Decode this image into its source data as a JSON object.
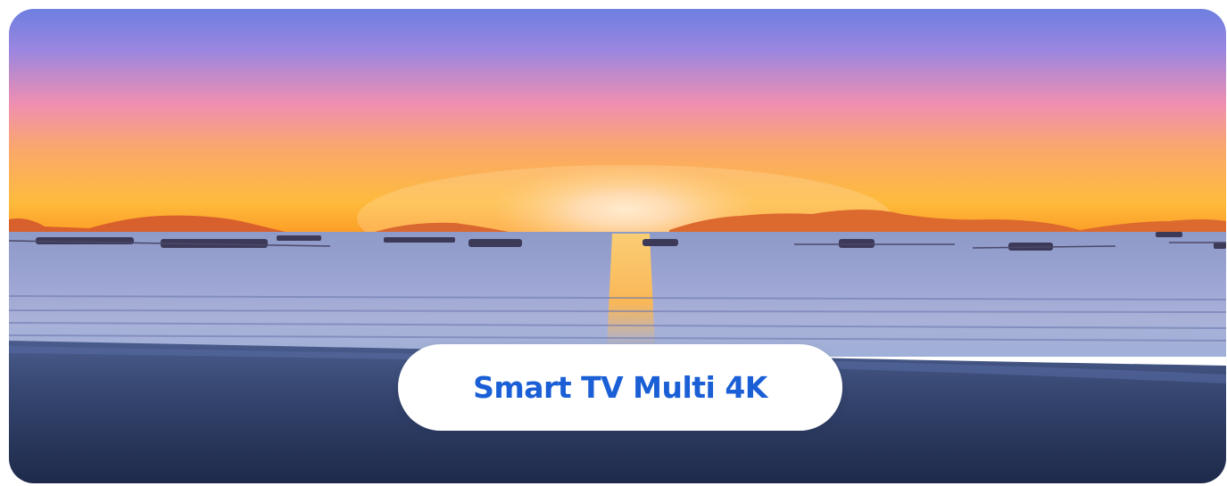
{
  "banner": {
    "image_icon": "sunset-beach-image",
    "cta_label": "Smart TV Multi 4K"
  },
  "colors": {
    "cta_text": "#1a5fd6",
    "cta_background": "#ffffff"
  }
}
